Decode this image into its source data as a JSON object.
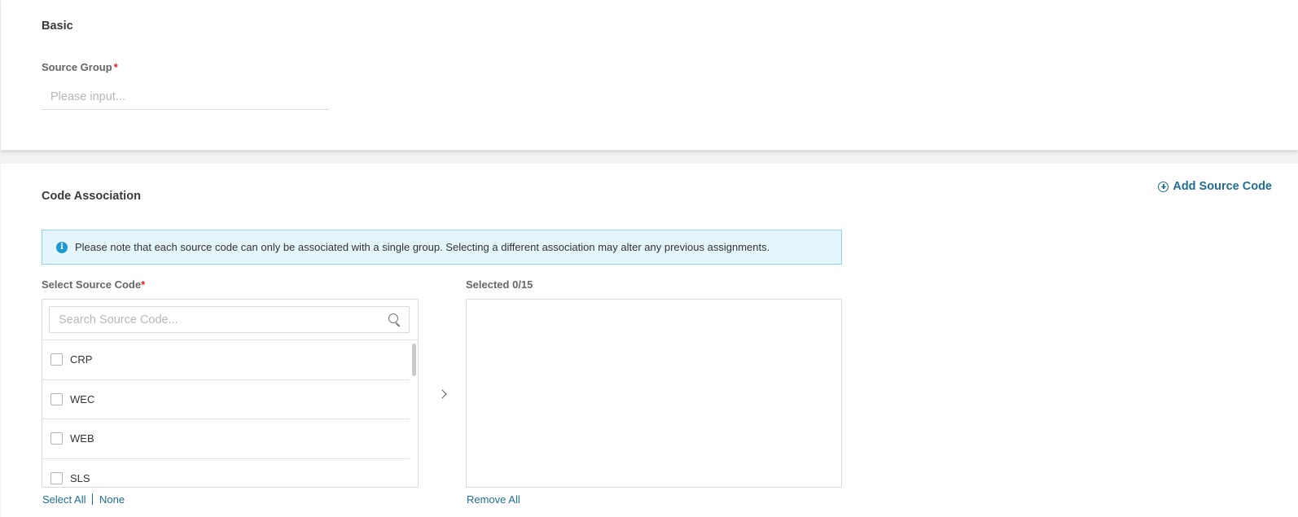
{
  "basic": {
    "title": "Basic",
    "source_group": {
      "label": "Source Group",
      "required_mark": "*",
      "placeholder": "Please input...",
      "value": ""
    }
  },
  "code_association": {
    "title": "Code Association",
    "add_source_code_label": "Add Source Code",
    "notice": "Please note that each source code can only be associated with a single group. Selecting a different association may alter any previous assignments.",
    "select_source_code": {
      "label": "Select Source Code",
      "required_mark": "*",
      "search_placeholder": "Search Source Code...",
      "items": [
        "CRP",
        "WEC",
        "WEB",
        "SLS"
      ],
      "select_all_label": "Select All",
      "none_label": "None"
    },
    "selected": {
      "label": "Selected 0/15",
      "remove_all_label": "Remove All"
    }
  },
  "colors": {
    "accent": "#1f6e93",
    "required": "#e02020",
    "info_bg": "#e5f5fc",
    "info_border": "#8fd3ec",
    "info_icon": "#1b9ad6"
  }
}
